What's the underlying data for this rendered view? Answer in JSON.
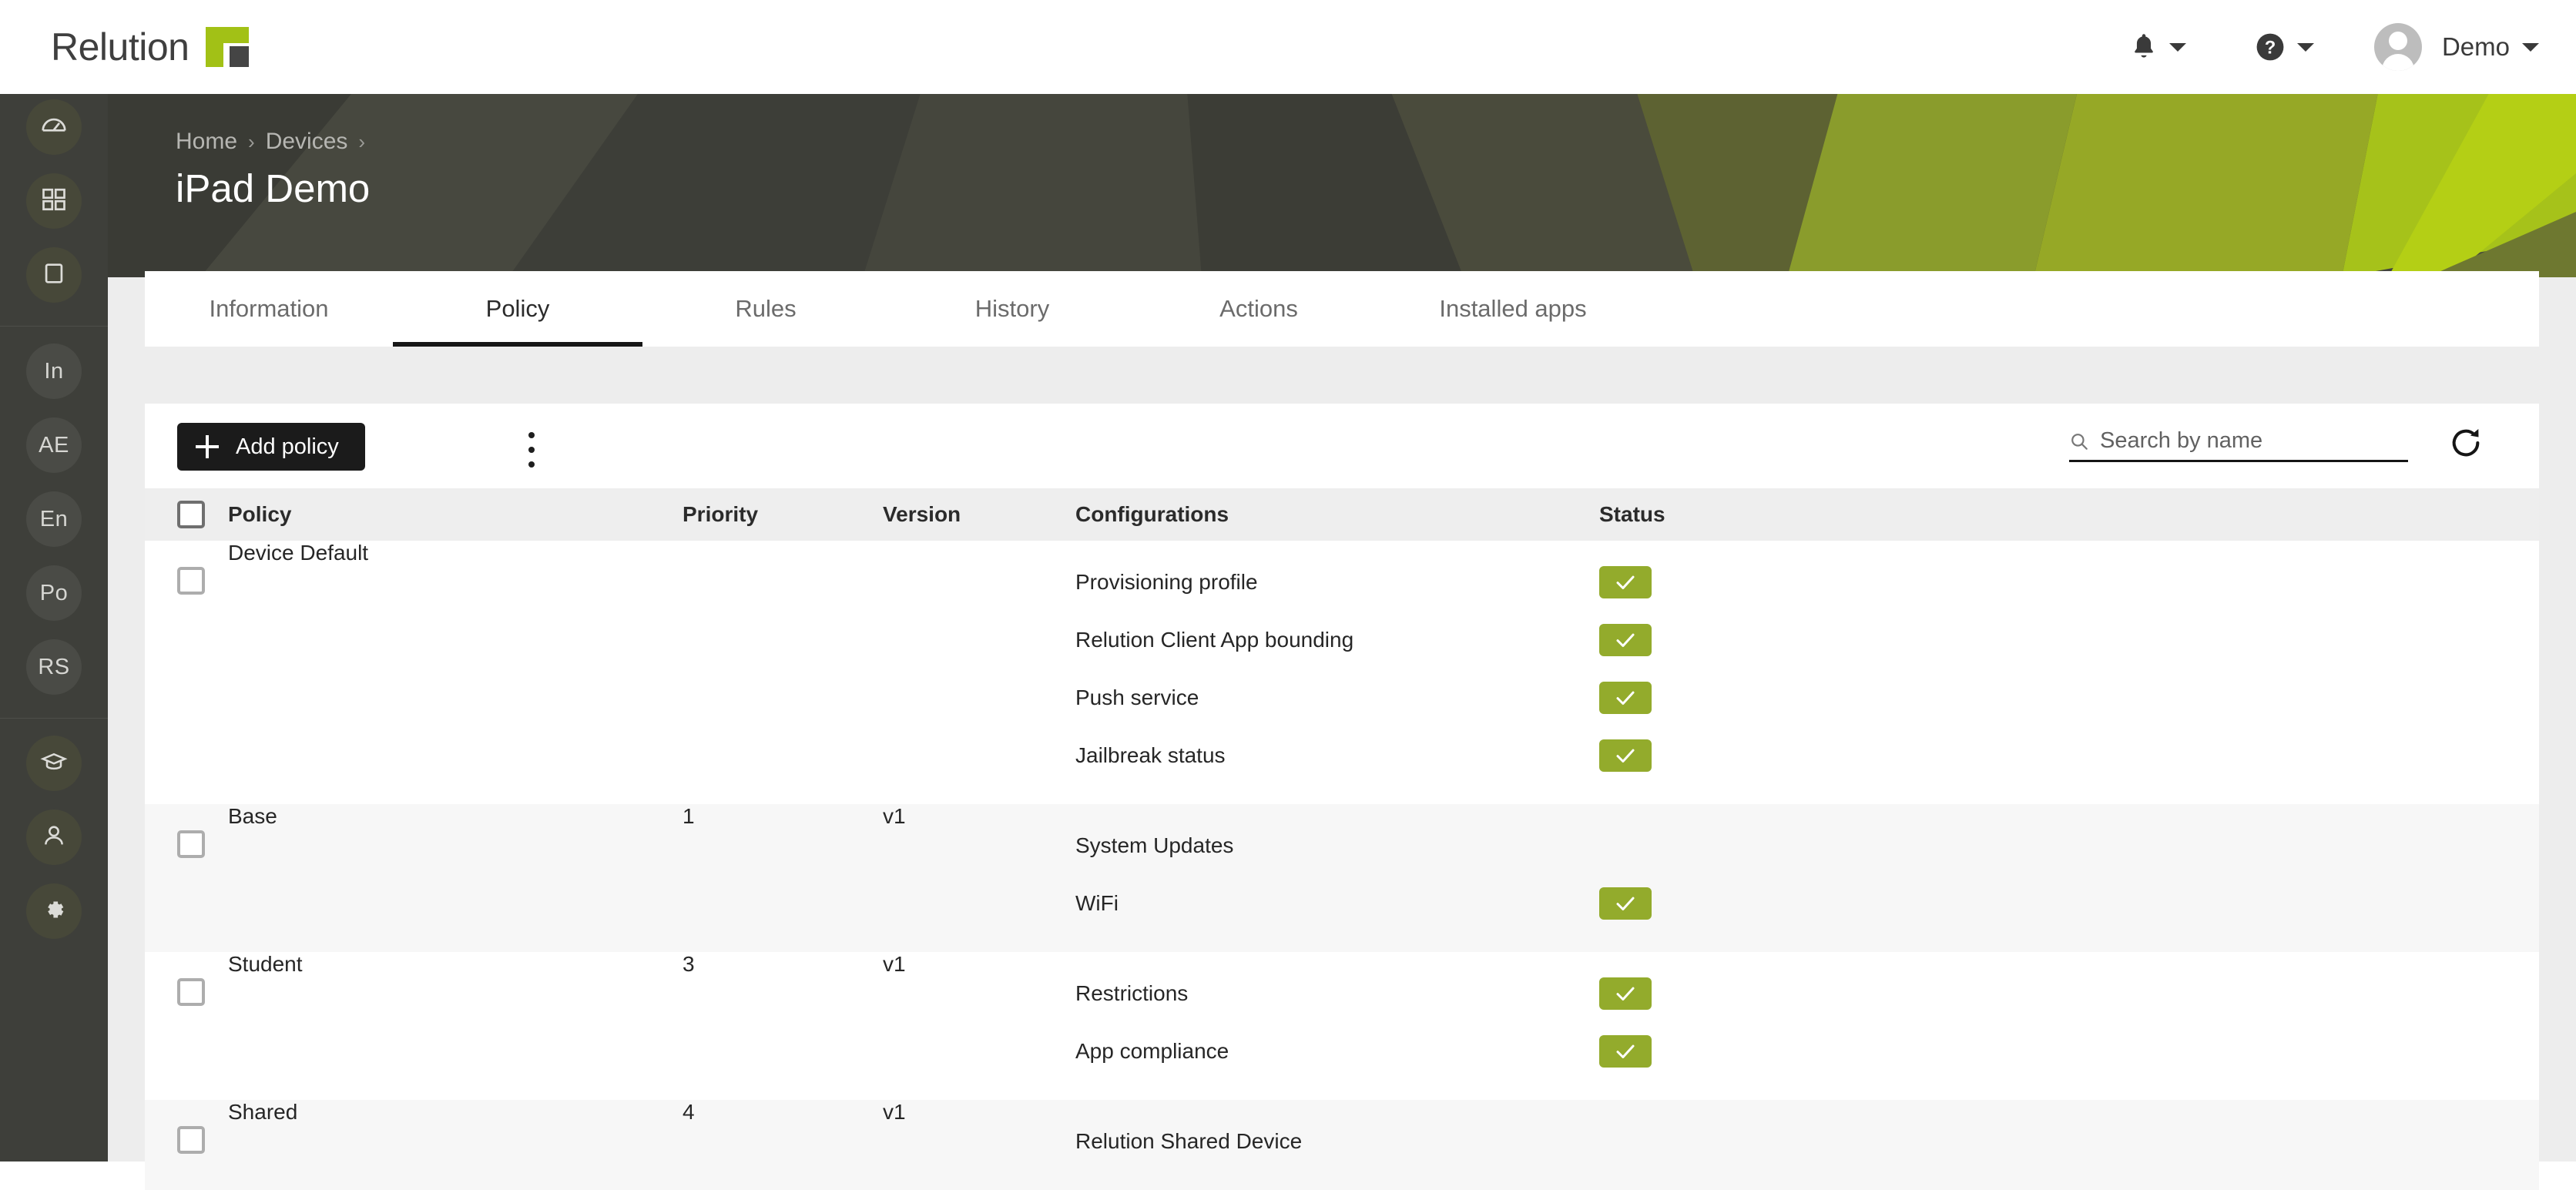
{
  "brand": {
    "name": "Relution",
    "logo_icon": "relution-logo-mark"
  },
  "topbar": {
    "notifications": {
      "icon": "bell-icon",
      "chevron": "chevron-down-icon"
    },
    "help": {
      "icon": "help-circle-icon",
      "chevron": "chevron-down-icon"
    },
    "user": {
      "name": "Demo",
      "avatar_icon": "user-avatar-icon",
      "chevron": "chevron-down-icon"
    }
  },
  "sidebar": {
    "groups": [
      {
        "items": [
          {
            "name": "dashboard",
            "icon": "gauge-icon",
            "label": ""
          },
          {
            "name": "apps",
            "icon": "grid-apps-icon",
            "label": ""
          },
          {
            "name": "devices",
            "icon": "tablet-icon",
            "label": ""
          }
        ]
      },
      {
        "items": [
          {
            "name": "inventory",
            "icon": "text-badge",
            "label": "In"
          },
          {
            "name": "apple-enrollment",
            "icon": "text-badge",
            "label": "AE"
          },
          {
            "name": "enrollment",
            "icon": "text-badge",
            "label": "En"
          },
          {
            "name": "policies",
            "icon": "text-badge",
            "label": "Po"
          },
          {
            "name": "relution-shared",
            "icon": "text-badge",
            "label": "RS"
          }
        ]
      },
      {
        "items": [
          {
            "name": "education",
            "icon": "graduation-cap-icon",
            "label": ""
          },
          {
            "name": "users",
            "icon": "person-icon",
            "label": ""
          },
          {
            "name": "settings",
            "icon": "gear-icon",
            "label": ""
          }
        ]
      }
    ]
  },
  "banner": {
    "breadcrumb": [
      "Home",
      "Devices"
    ],
    "separator": "›",
    "title": "iPad Demo"
  },
  "tabs": [
    {
      "label": "Information",
      "active": false
    },
    {
      "label": "Policy",
      "active": true
    },
    {
      "label": "Rules",
      "active": false
    },
    {
      "label": "History",
      "active": false
    },
    {
      "label": "Actions",
      "active": false
    },
    {
      "label": "Installed apps",
      "active": false
    }
  ],
  "toolbar": {
    "add_policy_label": "Add policy",
    "add_icon": "plus-icon",
    "more_icon": "kebab-menu-icon",
    "search_placeholder": "Search by name",
    "search_value": "",
    "search_icon": "search-icon",
    "refresh_icon": "refresh-icon"
  },
  "table": {
    "columns": [
      "",
      "Policy",
      "Priority",
      "Version",
      "Configurations",
      "Status"
    ],
    "rows": [
      {
        "policy": "Device Default",
        "priority": "",
        "version": "",
        "configurations": [
          {
            "name": "Provisioning profile",
            "status": "ok"
          },
          {
            "name": "Relution Client App bounding",
            "status": "ok"
          },
          {
            "name": "Push service",
            "status": "ok"
          },
          {
            "name": "Jailbreak status",
            "status": "ok"
          }
        ]
      },
      {
        "policy": "Base",
        "priority": "1",
        "version": "v1",
        "configurations": [
          {
            "name": "System Updates",
            "status": "none"
          },
          {
            "name": "WiFi",
            "status": "ok"
          }
        ]
      },
      {
        "policy": "Student",
        "priority": "3",
        "version": "v1",
        "configurations": [
          {
            "name": "Restrictions",
            "status": "ok"
          },
          {
            "name": "App compliance",
            "status": "ok"
          }
        ]
      },
      {
        "policy": "Shared",
        "priority": "4",
        "version": "v1",
        "configurations": [
          {
            "name": "Relution Shared Device",
            "status": "none"
          }
        ]
      }
    ]
  },
  "colors": {
    "brand_green": "#a2c116",
    "status_green": "#93ab2c",
    "sidebar_bg": "#3e3f3a",
    "banner_dark": "#42433d",
    "accent_dark": "#1b1b1b"
  }
}
